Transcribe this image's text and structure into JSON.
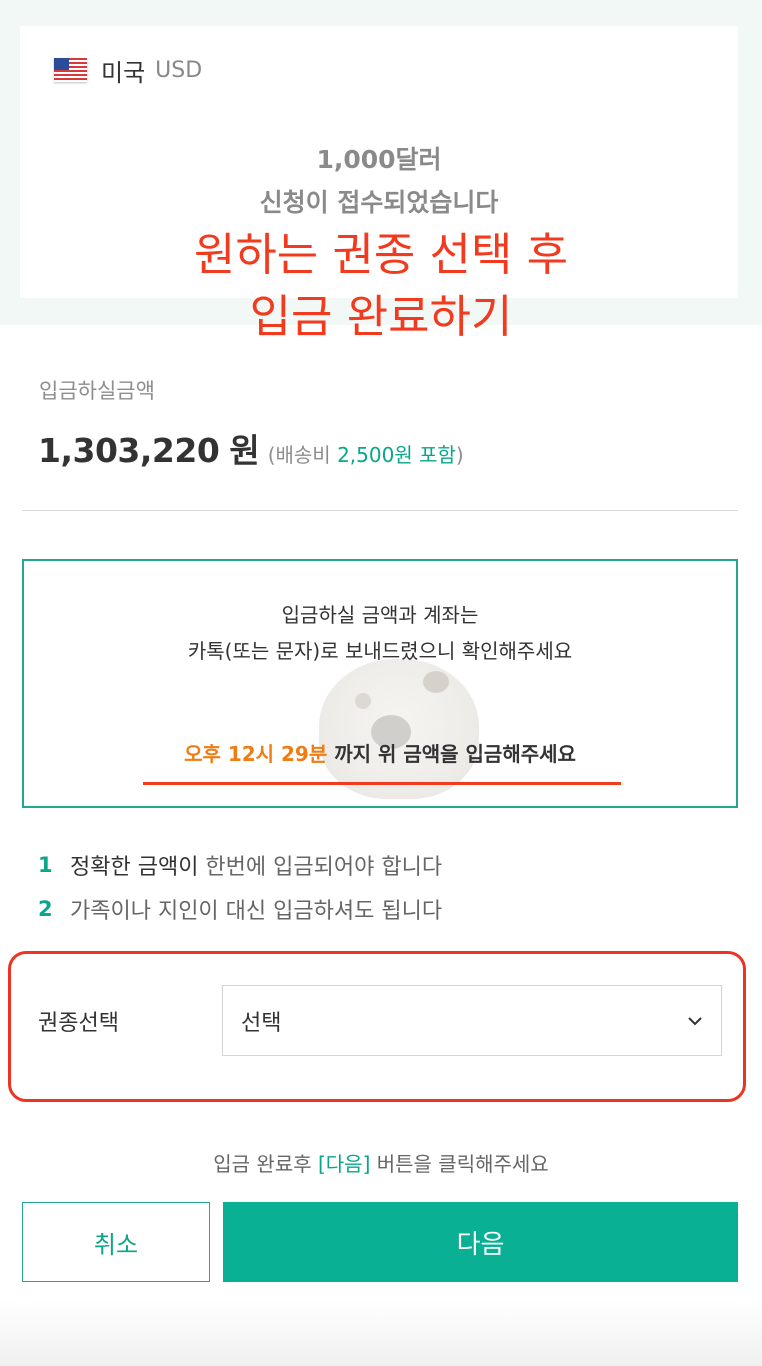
{
  "header": {
    "country_name": "미국",
    "currency_code": "USD",
    "notice_line1": "1,000달러",
    "notice_line2": "신청이 접수되었습니다"
  },
  "overlay": {
    "line1": "원하는 권종 선택 후",
    "line2": "입금 완료하기"
  },
  "amount": {
    "label": "입금하실금액",
    "value": "1,303,220",
    "unit": "원",
    "shipping_prefix": "(배송비",
    "shipping_fee": "2,500원 포함",
    "shipping_suffix": ")"
  },
  "info": {
    "line1": "입금하실 금액과 계좌는",
    "line2": "카톡(또는 문자)로 보내드렸으니 확인해주세요",
    "deadline_time": "오후 12시 29분",
    "deadline_text": " 까지 위 금액을 입금해주세요"
  },
  "rules": [
    {
      "num": "1",
      "strong": "정확한 금액이",
      "text": " 한번에 입금되어야 합니다"
    },
    {
      "num": "2",
      "strong": "",
      "text": "가족이나 지인이 대신 입금하셔도 됩니다"
    }
  ],
  "denomination": {
    "label": "권종선택",
    "selected": "선택"
  },
  "footer": {
    "hint_prefix": "입금 완료후 ",
    "hint_link": "[다음]",
    "hint_suffix": " 버튼을 클릭해주세요",
    "cancel_label": "취소",
    "next_label": "다음"
  },
  "colors": {
    "accent": "#0ab093",
    "annotation_red": "#f23a1e",
    "deadline_orange": "#ef7d14"
  },
  "icons": {
    "flag": "us-flag-icon",
    "dropdown": "chevron-down-icon"
  }
}
